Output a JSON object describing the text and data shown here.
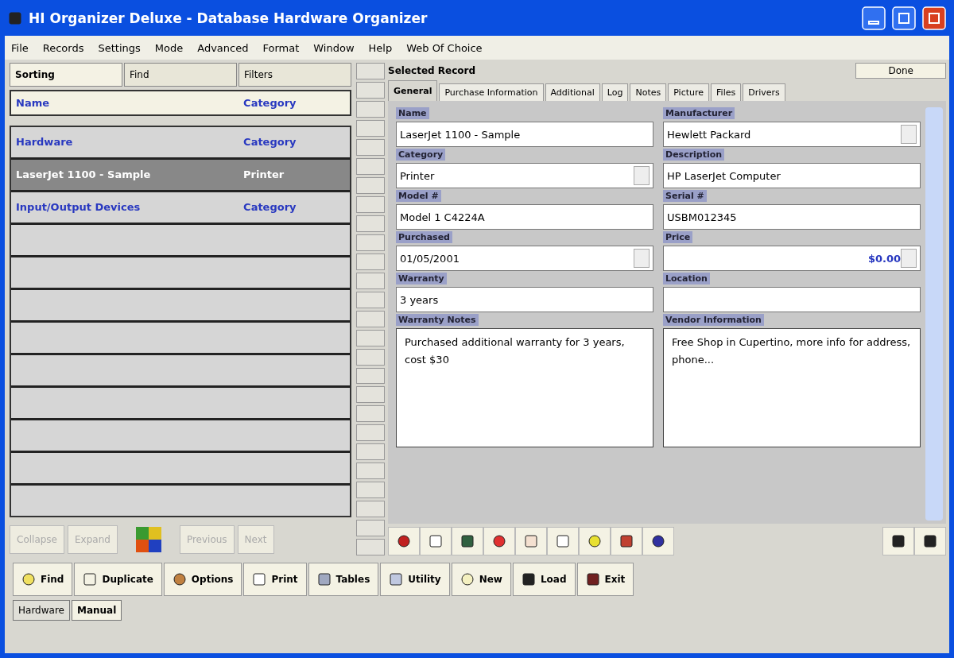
{
  "window": {
    "title": "HI Organizer Deluxe - Database Hardware Organizer"
  },
  "menu": [
    "File",
    "Records",
    "Settings",
    "Mode",
    "Advanced",
    "Format",
    "Window",
    "Help",
    "Web Of Choice"
  ],
  "left_tabs": [
    {
      "label": "Sorting",
      "selected": true
    },
    {
      "label": "Find",
      "selected": false
    },
    {
      "label": "Filters",
      "selected": false
    }
  ],
  "list": {
    "columns": [
      "Name",
      "Category"
    ],
    "rows": [
      {
        "name": "Hardware",
        "category": "Category",
        "selected": false
      },
      {
        "name": "LaserJet 1100 - Sample",
        "category": "Printer",
        "selected": true
      },
      {
        "name": "Input/Output Devices",
        "category": "Category",
        "selected": false
      }
    ]
  },
  "left_buttons": [
    {
      "label": "Collapse",
      "disabled": true
    },
    {
      "label": "Expand",
      "disabled": true
    },
    {
      "label": "Previous",
      "disabled": true
    },
    {
      "label": "Next",
      "disabled": true
    }
  ],
  "record": {
    "header": "Selected Record",
    "done_button": "Done",
    "tabs": [
      {
        "label": "General",
        "selected": true
      },
      {
        "label": "Purchase Information",
        "selected": false
      },
      {
        "label": "Additional",
        "selected": false
      },
      {
        "label": "Log",
        "selected": false
      },
      {
        "label": "Notes",
        "selected": false
      },
      {
        "label": "Picture",
        "selected": false
      },
      {
        "label": "Files",
        "selected": false
      },
      {
        "label": "Drivers",
        "selected": false
      }
    ],
    "fields": [
      {
        "label": "Name",
        "value": "LaserJet 1100 - Sample",
        "kind": "text"
      },
      {
        "label": "Manufacturer",
        "value": "Hewlett Packard",
        "kind": "dropdown"
      },
      {
        "label": "Category",
        "value": "Printer",
        "kind": "dropdown"
      },
      {
        "label": "Description",
        "value": "HP LaserJet Computer",
        "kind": "text"
      },
      {
        "label": "Model #",
        "value": "Model 1 C4224A",
        "kind": "text"
      },
      {
        "label": "Serial #",
        "value": "USBM012345",
        "kind": "text"
      },
      {
        "label": "Purchased",
        "value": "01/05/2001",
        "kind": "spin"
      },
      {
        "label": "Price",
        "value": "$0.00",
        "kind": "spin"
      },
      {
        "label": "Warranty",
        "value": "3 years",
        "kind": "text"
      },
      {
        "label": "Location",
        "kind": "text"
      },
      {
        "label": "Warranty Notes",
        "value": "Purchased additional warranty for 3 years, cost $30",
        "kind": "memo"
      },
      {
        "label": "Vendor Information",
        "value": "Free Shop in Cupertino, more info for address, phone...",
        "kind": "memo"
      }
    ]
  },
  "bottom_toolbar": [
    "Find",
    "Duplicate",
    "Options",
    "Print",
    "Tables",
    "Utility",
    "New",
    "Load",
    "Exit"
  ],
  "bottom_tabs": [
    {
      "label": "Hardware",
      "selected": false
    },
    {
      "label": "Manual",
      "selected": true
    }
  ]
}
